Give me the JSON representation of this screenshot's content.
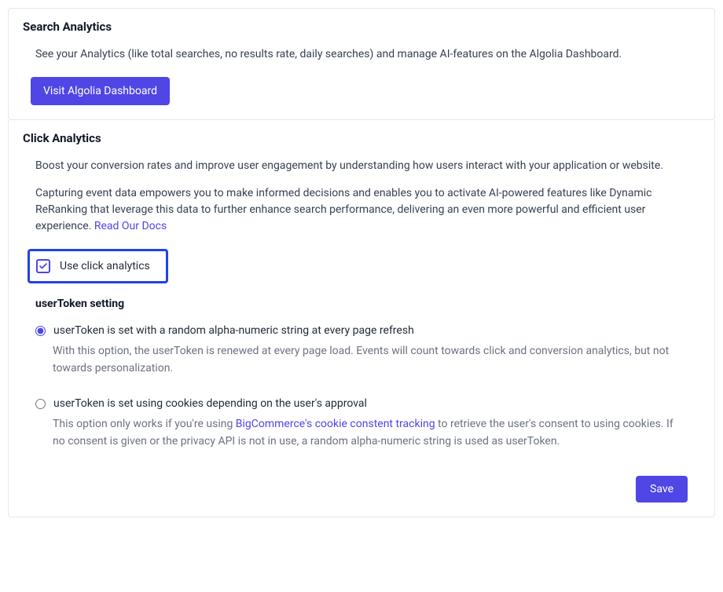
{
  "searchAnalytics": {
    "title": "Search Analytics",
    "description": "See your Analytics (like total searches, no results rate, daily searches) and manage AI-features on the Algolia Dashboard.",
    "buttonLabel": "Visit Algolia Dashboard"
  },
  "clickAnalytics": {
    "title": "Click Analytics",
    "desc1": "Boost your conversion rates and improve user engagement by understanding how users interact with your application or website.",
    "desc2a": "Capturing event data empowers you to make informed decisions and enables you to activate AI-powered features like Dynamic ReRanking that leverage this data to further enhance search performance, delivering an even more powerful and efficient user experience. ",
    "docsLink": "Read Our Docs",
    "checkboxLabel": "Use click analytics",
    "checkboxChecked": true,
    "userTokenHeading": "userToken setting",
    "options": [
      {
        "label": "userToken is set with a random alpha-numeric string at every page refresh",
        "description": "With this option, the userToken is renewed at every page load. Events will count towards click and conversion analytics, but not towards personalization.",
        "selected": true
      },
      {
        "label": "userToken is set using cookies depending on the user's approval",
        "descPre": "This option only works if you're using ",
        "descLink": "BigCommerce's cookie constent tracking",
        "descPost": " to retrieve the user's consent to using cookies. If no consent is given or the privacy API is not in use, a random alpha-numeric string is used as userToken.",
        "selected": false
      }
    ],
    "saveLabel": "Save"
  }
}
